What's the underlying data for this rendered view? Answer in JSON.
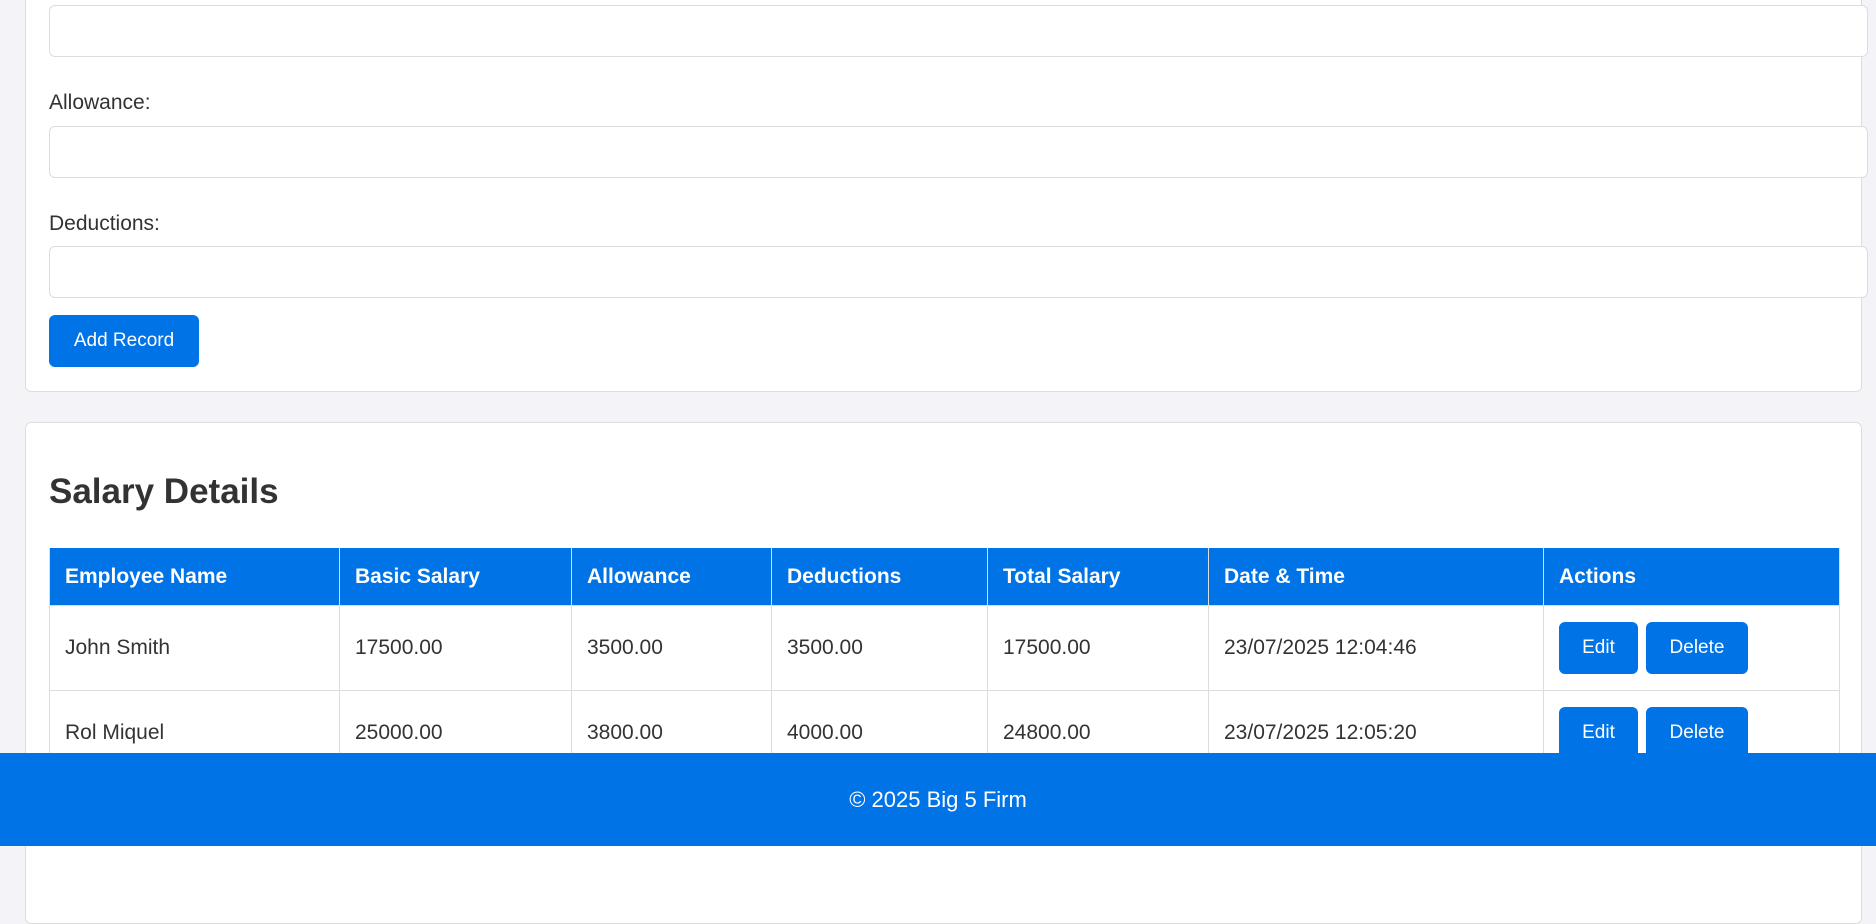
{
  "form": {
    "fields": [
      {
        "label": "",
        "value": ""
      },
      {
        "label": "Allowance:",
        "value": ""
      },
      {
        "label": "Deductions:",
        "value": ""
      }
    ],
    "add_button": "Add Record"
  },
  "salary": {
    "title": "Salary Details",
    "columns": [
      "Employee Name",
      "Basic Salary",
      "Allowance",
      "Deductions",
      "Total Salary",
      "Date & Time",
      "Actions"
    ],
    "rows": [
      {
        "name": "John Smith",
        "basic": "17500.00",
        "allowance": "3500.00",
        "deductions": "3500.00",
        "total": "17500.00",
        "datetime": "23/07/2025 12:04:46"
      },
      {
        "name": "Rol Miquel",
        "basic": "25000.00",
        "allowance": "3800.00",
        "deductions": "4000.00",
        "total": "24800.00",
        "datetime": "23/07/2025 12:05:20"
      }
    ],
    "edit_label": "Edit",
    "delete_label": "Delete"
  },
  "footer": {
    "text": "© 2025 Big 5 Firm"
  },
  "colors": {
    "accent": "#0073e6",
    "background": "#f4f4f8"
  }
}
